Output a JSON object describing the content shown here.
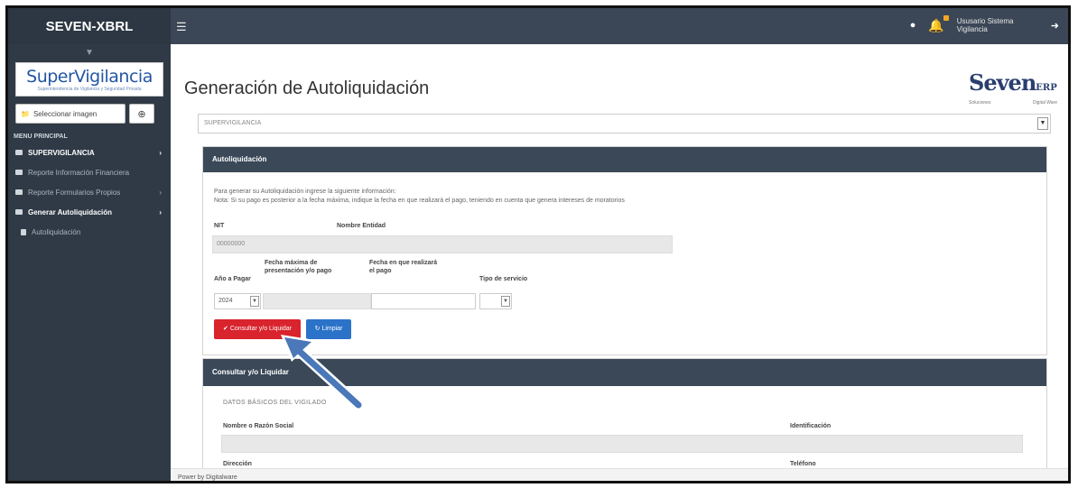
{
  "app": {
    "brand": "SEVEN-XBRL",
    "user": "Ususario Sistema Vigilancia"
  },
  "sidebar": {
    "logo_text": "SuperVigilancia",
    "logo_sub": "Superintendencia de Vigilancia y Seguridad Privada",
    "select_image": "Seleccionar imagen",
    "menu_header": "MENU PRINCIPAL",
    "items": [
      {
        "label": "SUPERVIGILANCIA"
      },
      {
        "label": "Reporte Información Financiera"
      },
      {
        "label": "Reporte Formularios Propios"
      },
      {
        "label": "Generar Autoliquidación"
      },
      {
        "label": "Autoliquidación"
      }
    ]
  },
  "page": {
    "title": "Generación de Autoliquidación",
    "entity_select": "SUPERVIGILANCIA"
  },
  "logo": {
    "word": "Seven",
    "suffix": "ERP",
    "small_left": "Soluciones",
    "small_right": "Digital Ware"
  },
  "panel1": {
    "header": "Autoliquidación",
    "info1": "Para generar su Autoliquidación ingrese la siguiente información:",
    "info2": "Nota: Si su pago es posterior a la fecha máxima, indique la fecha en que realizará el pago, teniendo en cuenta que genera intereses de moratorios",
    "nit_label": "NIT",
    "nit_value": "00000000",
    "entity_label": "Nombre Entidad",
    "year_label": "Año a Pagar",
    "year_value": "2024",
    "max_date_label": "Fecha máxima de presentación y/o pago",
    "pay_date_label": "Fecha en que realizará el pago",
    "service_label": "Tipo de servicio",
    "btn_consult": "Consultar y/o Liquidar",
    "btn_clear": "Limpiar"
  },
  "panel2": {
    "header": "Consultar y/o Liquidar",
    "section": "DATOS BÁSICOS DEL VIGILADO",
    "name_label": "Nombre o Razón Social",
    "id_label": "Identificación",
    "addr_label": "Dirección",
    "phone_label": "Teléfono"
  },
  "footer": {
    "text": "Power by Digitalware"
  }
}
